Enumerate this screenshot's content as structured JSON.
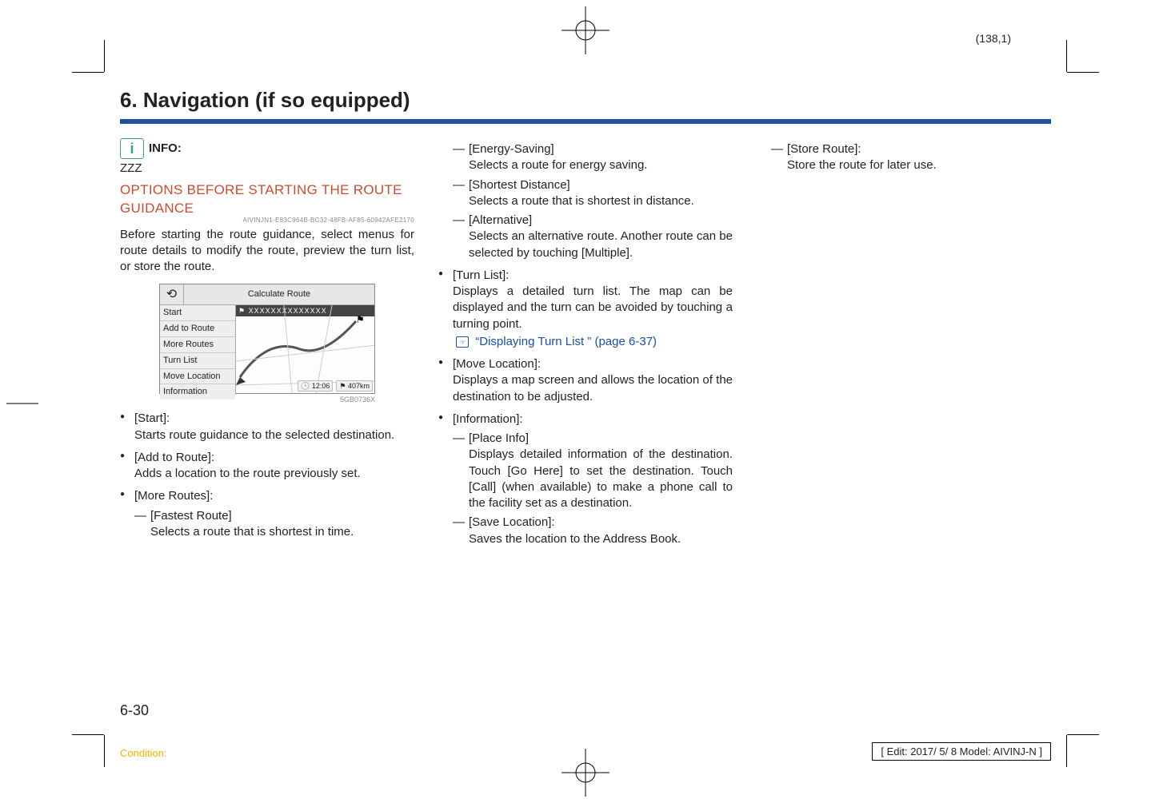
{
  "sheet_coord": "(138,1)",
  "chapter_title": "6. Navigation (if so equipped)",
  "info": {
    "label": "INFO:",
    "placeholder_text": "ZZZ"
  },
  "section": {
    "heading": "OPTIONS BEFORE STARTING THE ROUTE GUIDANCE",
    "guid": "AIVINJN1-E83C964B-BC32-48FB-AF85-60942AFE2170",
    "intro": "Before starting the route guidance, select menus for route details to modify the route, preview the turn list, or store the route."
  },
  "screenshot": {
    "title": "Calculate Route",
    "dest_bar": "⚑ XXXXXXXXXXXXXX",
    "menu": [
      "Start",
      "Add to Route",
      "More Routes",
      "Turn List",
      "Move Location",
      "Information"
    ],
    "time_chip": "🕒 12:06",
    "dist_chip": "⚑ 407km",
    "code": "5GB0736X"
  },
  "col1_items": [
    {
      "title": "[Start]:",
      "desc": "Starts route guidance to the selected destination."
    },
    {
      "title": "[Add to Route]:",
      "desc": "Adds a location to the route previously set."
    },
    {
      "title": "[More Routes]:",
      "subs": [
        {
          "title": "[Fastest Route]",
          "desc": "Selects a route that is shortest in time."
        }
      ]
    }
  ],
  "col2_pre_subs": [
    {
      "title": "[Energy-Saving]",
      "desc": "Selects a route for energy saving."
    },
    {
      "title": "[Shortest Distance]",
      "desc": "Selects a route that is shortest in distance."
    },
    {
      "title": "[Alternative]",
      "desc": "Selects an alternative route. Another route can be selected by touching [Multiple]."
    }
  ],
  "col2_items": [
    {
      "title": "[Turn List]:",
      "desc": "Displays a detailed turn list. The map can be displayed and the turn can be avoided by touching a turning point.",
      "xref": "“Displaying Turn List ” (page 6-37)"
    },
    {
      "title": "[Move Location]:",
      "desc": "Displays a map screen and allows the location of the destination to be adjusted."
    },
    {
      "title": "[Information]:",
      "subs": [
        {
          "title": "[Place Info]",
          "desc": "Displays detailed information of the destination. Touch [Go Here] to set the destination. Touch [Call] (when available) to make a phone call to the facility set as a destination."
        },
        {
          "title": "[Save Location]:",
          "desc": "Saves the location to the Address Book."
        }
      ]
    }
  ],
  "col3_pre_subs": [
    {
      "title": "[Store Route]:",
      "desc": "Store the route for later use."
    }
  ],
  "page_number": "6-30",
  "footer": {
    "condition": "Condition:",
    "edit": "[ Edit: 2017/ 5/ 8   Model: AIVINJ-N ]"
  }
}
